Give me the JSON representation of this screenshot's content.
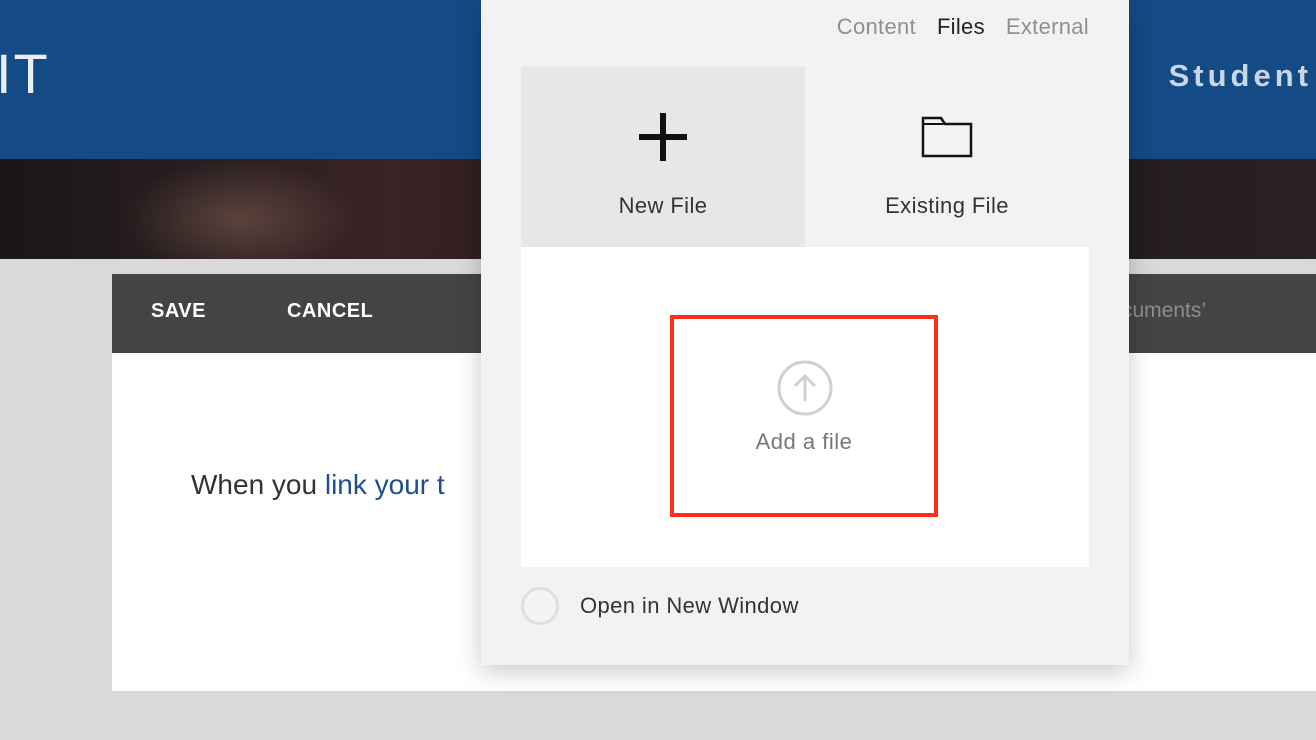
{
  "header": {
    "logo_text": "IT",
    "nav_item": "Student"
  },
  "editor": {
    "toolbar": {
      "save_label": "SAVE",
      "cancel_label": "CANCEL",
      "hint_text": "cuments’"
    },
    "body": {
      "text_before_link": "When you ",
      "link_text": "link your t"
    }
  },
  "link_dialog": {
    "tabs": [
      {
        "label": "Content",
        "active": false
      },
      {
        "label": "Files",
        "active": true
      },
      {
        "label": "External",
        "active": false
      }
    ],
    "source_options": {
      "new_file": {
        "label": "New File",
        "icon": "plus-icon",
        "selected": true
      },
      "existing_file": {
        "label": "Existing File",
        "icon": "folder-icon",
        "selected": false
      }
    },
    "upload": {
      "label": "Add a file",
      "icon": "upload-arrow-icon"
    },
    "new_window": {
      "label": "Open in New Window",
      "checked": false
    }
  },
  "colors": {
    "header_bg": "#144a85",
    "toolbar_bg": "#444444",
    "highlight_border": "#ff2e1f",
    "link_color": "#1d4f91"
  }
}
